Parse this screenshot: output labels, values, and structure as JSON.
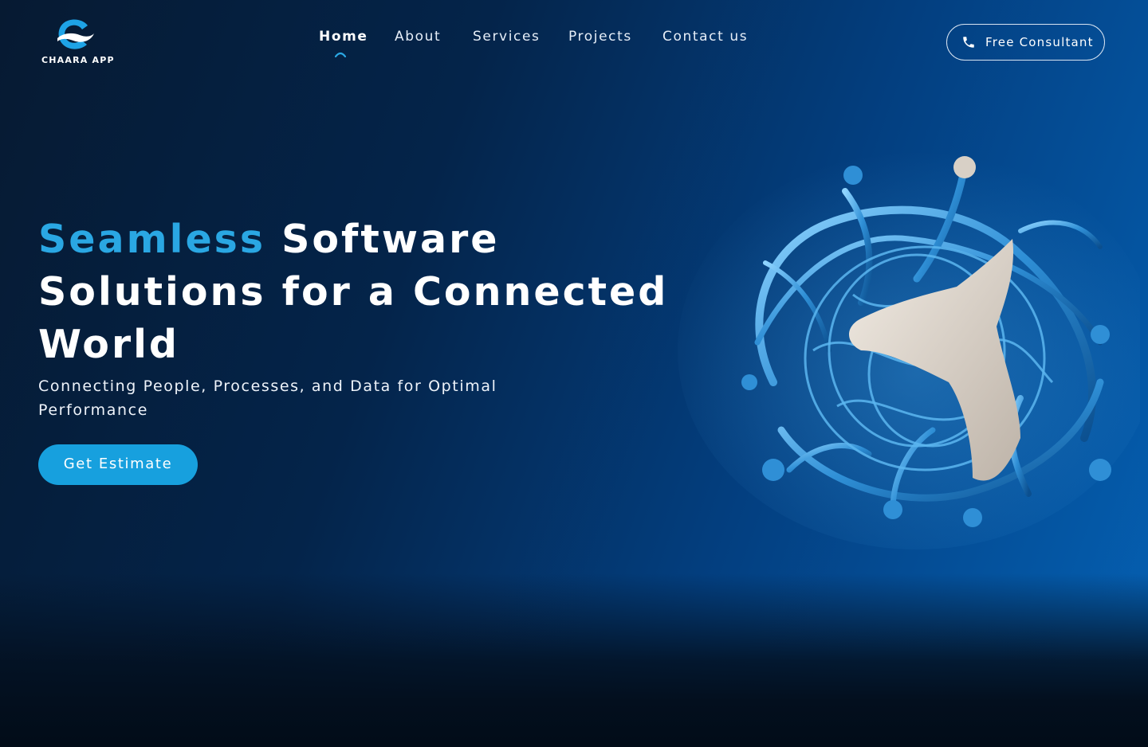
{
  "brand": {
    "name": "CHAARA APP",
    "logo_icon": "c-swirl-logo-icon",
    "colors": {
      "accent": "#2aa7e3",
      "logo_blue": "#1ea3e6",
      "button": "#17a0de"
    }
  },
  "nav": {
    "items": [
      {
        "label": "Home",
        "active": true
      },
      {
        "label": "About",
        "active": false
      },
      {
        "label": "Services",
        "active": false
      },
      {
        "label": "Projects",
        "active": false
      },
      {
        "label": "Contact us",
        "active": false
      }
    ],
    "indicator_icon": "arc-indicator-icon"
  },
  "header_cta": {
    "label": "Free Consultant",
    "icon": "phone-icon"
  },
  "hero": {
    "title_accent": "Seamless",
    "title_line1_rest": "Software",
    "title_line2": "Solutions for a Connected",
    "title_line3": "World",
    "subtitle": "Connecting People, Processes, and Data for Optimal Performance",
    "cta_label": "Get Estimate",
    "art": "abstract-3d-network-sculpture"
  }
}
